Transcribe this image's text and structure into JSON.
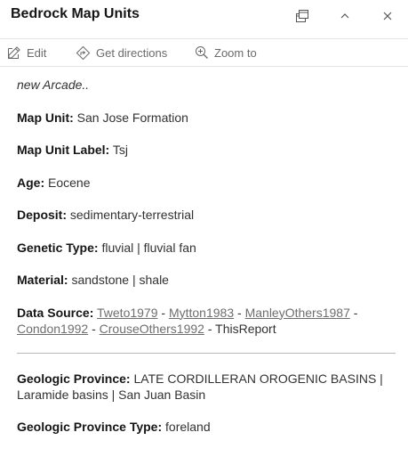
{
  "header": {
    "title": "Bedrock Map Units",
    "dock_icon": "dock-icon",
    "collapse_icon": "chevron-up-icon",
    "close_icon": "close-icon"
  },
  "toolbar": {
    "edit_label": "Edit",
    "edit_icon": "edit-pencil-icon",
    "directions_label": "Get directions",
    "directions_icon": "directions-icon",
    "zoom_label": "Zoom to",
    "zoom_icon": "zoom-magnifier-icon"
  },
  "content": {
    "note": "new Arcade..",
    "map_unit_label": "Map Unit:",
    "map_unit_value": "San Jose Formation",
    "map_unit_label_label": "Map Unit Label:",
    "map_unit_label_value": "Tsj",
    "age_label": "Age:",
    "age_value": "Eocene",
    "deposit_label": "Deposit:",
    "deposit_value": "sedimentary-terrestrial",
    "genetic_type_label": "Genetic Type:",
    "genetic_type_value": "fluvial | fluvial fan",
    "material_label": "Material:",
    "material_value": "sandstone | shale",
    "data_source_label": "Data Source:",
    "data_sources": [
      "Tweto1979",
      "Mytton1983",
      "ManleyOthers1987",
      "Condon1992",
      "CrouseOthers1992"
    ],
    "separator": " - ",
    "data_source_tail": "ThisReport",
    "province_label": "Geologic Province:",
    "province_value": "LATE CORDILLERAN OROGENIC BASINS | Laramide basins | San Juan Basin",
    "province_type_label": "Geologic Province Type:",
    "province_type_value": "foreland"
  }
}
